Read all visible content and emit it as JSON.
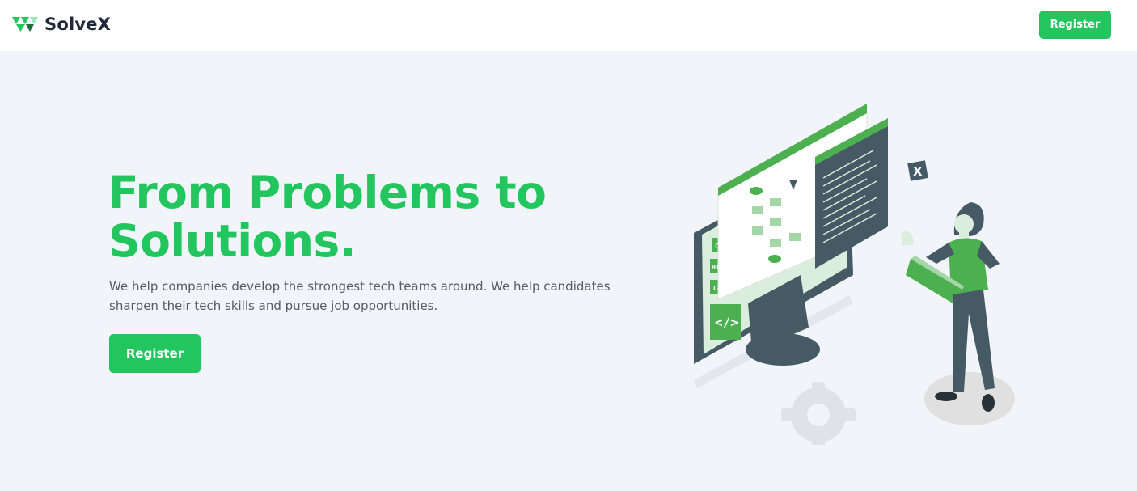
{
  "brand": {
    "name": "SolveX",
    "logo_icon": "triangle-logo-icon"
  },
  "nav": {
    "register_label": "Register"
  },
  "hero": {
    "title": "From Problems to Solutions.",
    "subtitle": "We help companies develop the strongest tech teams around. We help candidates sharpen their tech skills and pursue job opportunities.",
    "register_label": "Register"
  },
  "illustration": {
    "tags": [
      "CSS",
      "HTML",
      "C++"
    ],
    "code_icon": "</>",
    "close_icon": "X"
  },
  "colors": {
    "accent": "#22c55e",
    "dark": "#455a64",
    "background": "#f1f4f9"
  }
}
